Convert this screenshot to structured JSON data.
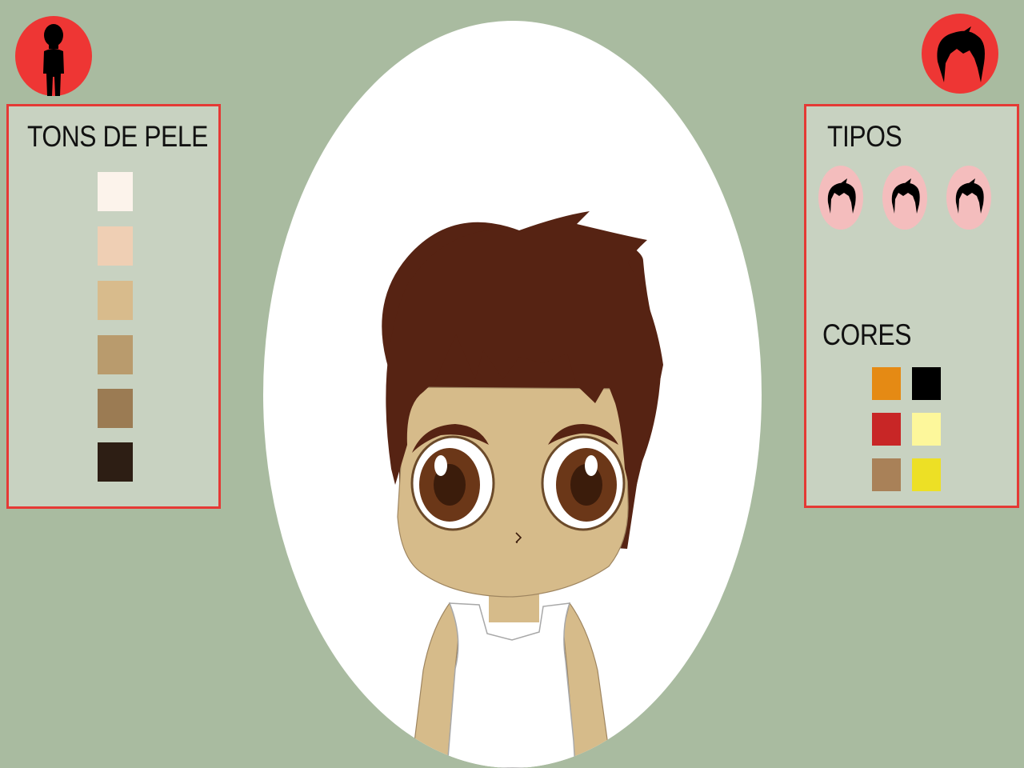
{
  "tabs": {
    "body": {
      "icon": "body-silhouette-icon",
      "color": "#ee3634"
    },
    "hair": {
      "icon": "hair-icon",
      "color": "#ee3634"
    }
  },
  "skin_panel": {
    "title": "TONS DE PELE",
    "swatches": [
      "#fcf3eb",
      "#efcfb4",
      "#d8bb8c",
      "#b99b6d",
      "#9b7b53",
      "#2d1e14"
    ]
  },
  "hair_panel": {
    "types_title": "TIPOS",
    "types": [
      "hair-style-1-icon",
      "hair-style-2-icon",
      "hair-style-3-icon"
    ],
    "colors_title": "CORES",
    "colors": [
      "#e58a14",
      "#000000",
      "#c82626",
      "#fdf79b",
      "#a98158",
      "#ede025"
    ]
  },
  "avatar": {
    "skin_color": "#d6bb8a",
    "hair_color": "#562313",
    "eye_color": "#6b3718",
    "shirt_color": "#ffffff"
  }
}
